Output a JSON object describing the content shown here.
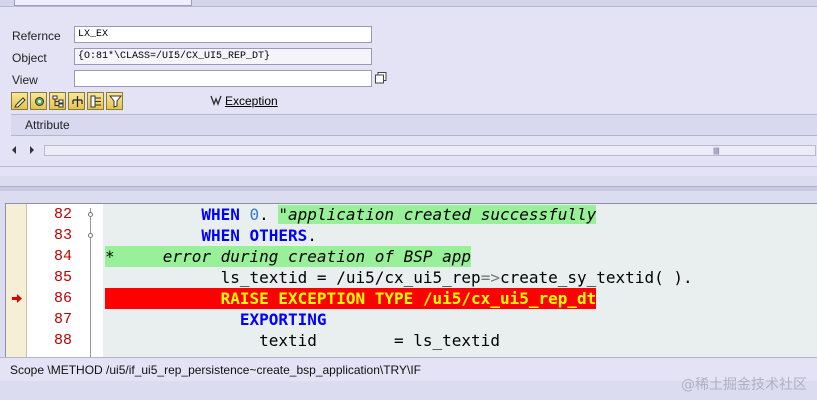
{
  "inspector": {
    "fields": [
      {
        "label": "Refernce",
        "value": "LX_EX"
      },
      {
        "label": "Object",
        "value": "{O:81*\\CLASS=/UI5/CX_UI5_REP_DT}"
      },
      {
        "label": "View",
        "value": ""
      }
    ],
    "toolbar_icons": [
      "pencil-icon",
      "gear-eye-icon",
      "hierarchy-icon",
      "tree-icon",
      "structure-icon",
      "filter-icon"
    ],
    "exception_link": "Exception",
    "attribute_header": "Attribute"
  },
  "editor": {
    "lines": [
      {
        "num": "82",
        "segments": [
          {
            "t": "          ",
            "c": ""
          },
          {
            "t": "WHEN",
            "c": "kw"
          },
          {
            "t": " ",
            "c": ""
          },
          {
            "t": "0",
            "c": "num"
          },
          {
            "t": ". ",
            "c": ""
          },
          {
            "t": "\"application created successfully",
            "c": "cmt-inline"
          }
        ],
        "fold": true,
        "style": ""
      },
      {
        "num": "83",
        "segments": [
          {
            "t": "          ",
            "c": ""
          },
          {
            "t": "WHEN",
            "c": "kw"
          },
          {
            "t": " ",
            "c": ""
          },
          {
            "t": "OTHERS",
            "c": "kw"
          },
          {
            "t": ".",
            "c": ""
          }
        ],
        "fold": true,
        "style": ""
      },
      {
        "num": "84",
        "segments": [
          {
            "t": "*     error during creation of BSP app",
            "c": ""
          }
        ],
        "fold": false,
        "style": "cmt-line"
      },
      {
        "num": "85",
        "segments": [
          {
            "t": "            ls_textid = /ui5/cx_ui5_rep",
            "c": ""
          },
          {
            "t": "=>",
            "c": "arrow-op"
          },
          {
            "t": "create_sy_textid( ).",
            "c": ""
          }
        ],
        "fold": false,
        "style": ""
      },
      {
        "num": "86",
        "segments": [
          {
            "t": "            RAISE EXCEPTION TYPE /ui5/cx_ui5_rep_dt",
            "c": ""
          }
        ],
        "fold": false,
        "style": "err-line"
      },
      {
        "num": "87",
        "segments": [
          {
            "t": "              ",
            "c": ""
          },
          {
            "t": "EXPORTING",
            "c": "kw"
          }
        ],
        "fold": false,
        "style": ""
      },
      {
        "num": "88",
        "segments": [
          {
            "t": "                textid        = ls_textid",
            "c": ""
          }
        ],
        "fold": false,
        "style": ""
      }
    ],
    "current_line_marker": "86"
  },
  "status": {
    "scope": "Scope \\METHOD /ui5/if_ui5_rep_persistence~create_bsp_application\\TRY\\IF"
  },
  "watermark": "@稀土掘金技术社区",
  "colors": {
    "keyword": "#0000ff",
    "line_number": "#c00000",
    "comment_bg": "#98f098",
    "error_bg": "#ff0000",
    "error_text": "#ffff00"
  }
}
